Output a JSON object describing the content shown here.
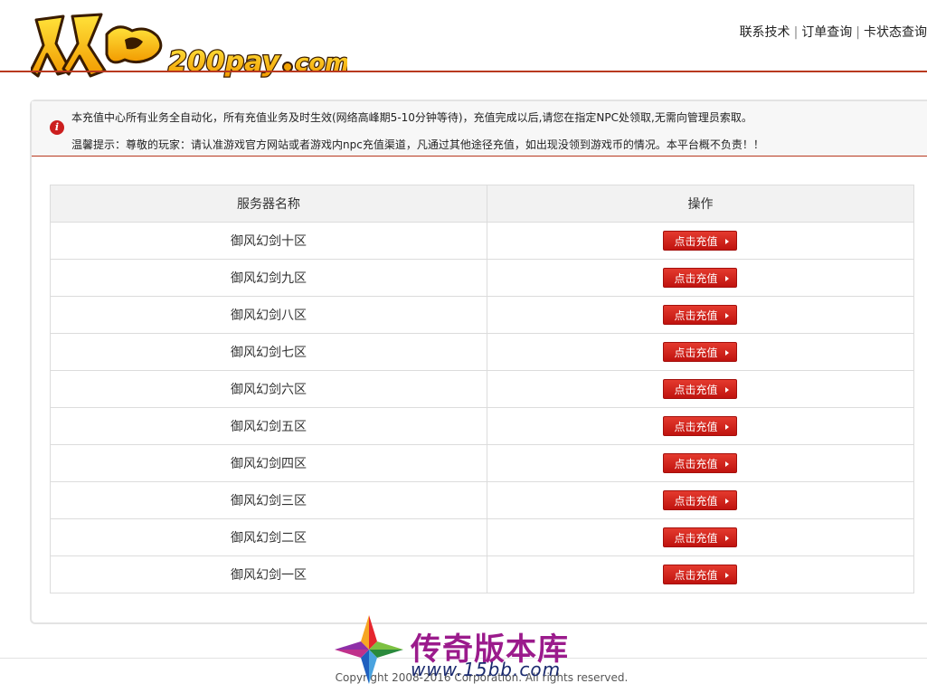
{
  "header": {
    "logo_text": "双龙200pay.com",
    "links": [
      {
        "label": "联系技术"
      },
      {
        "label": "订单查询"
      },
      {
        "label": "卡状态查询"
      }
    ],
    "separator": "|"
  },
  "notice": {
    "line1": "本充值中心所有业务全自动化，所有充值业务及时生效(网络高峰期5-10分钟等待)，充值完成以后,请您在指定NPC处领取,无需向管理员索取。",
    "line2": "温馨提示：尊敬的玩家：请认准游戏官方网站或者游戏内npc充值渠道，凡通过其他途径充值，如出现没领到游戏币的情况。本平台概不负责！！"
  },
  "table": {
    "headers": {
      "name": "服务器名称",
      "operation": "操作"
    },
    "button_label": "点击充值",
    "rows": [
      {
        "name": "御风幻剑十区"
      },
      {
        "name": "御风幻剑九区"
      },
      {
        "name": "御风幻剑八区"
      },
      {
        "name": "御风幻剑七区"
      },
      {
        "name": "御风幻剑六区"
      },
      {
        "name": "御风幻剑五区"
      },
      {
        "name": "御风幻剑四区"
      },
      {
        "name": "御风幻剑三区"
      },
      {
        "name": "御风幻剑二区"
      },
      {
        "name": "御风幻剑一区"
      }
    ]
  },
  "footer": {
    "copyright": "Copyright 2008-2016 Corporation. All rights reserved."
  },
  "watermark": {
    "title": "传奇版本库",
    "url": "www.15bb.com"
  },
  "colors": {
    "accent": "#b8391f",
    "button": "#d4201a",
    "notice_icon": "#cc1f1f"
  }
}
